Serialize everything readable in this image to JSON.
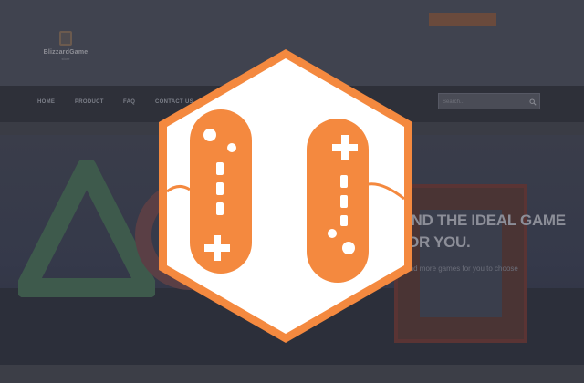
{
  "header": {
    "topbar_button_label": ""
  },
  "logo": {
    "name": "BlizzardGame",
    "tagline": "store"
  },
  "nav": {
    "items": [
      {
        "label": "HOME"
      },
      {
        "label": "PRODUCT"
      },
      {
        "label": "FAQ"
      },
      {
        "label": "CONTACT US"
      }
    ]
  },
  "search": {
    "placeholder": "Search..."
  },
  "hero": {
    "title": "FIND THE IDEAL GAME FOR YOU.",
    "subtitle": "Find more games for you to choose"
  },
  "overlay": {
    "icon": "gamepad-loader-icon",
    "colors": {
      "accent": "#f4893f",
      "background": "#ffffff"
    }
  }
}
